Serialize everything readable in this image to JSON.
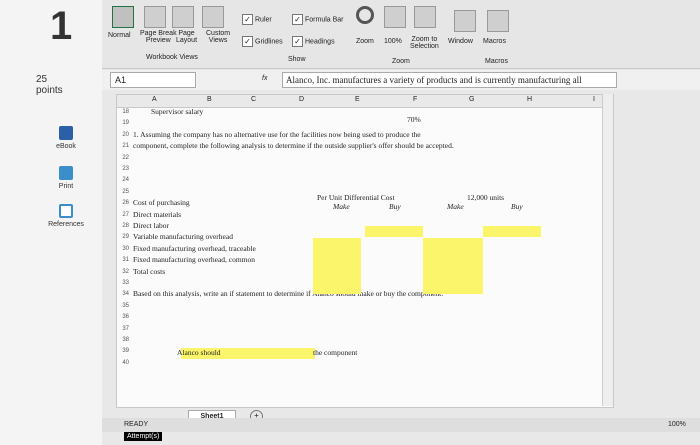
{
  "left": {
    "question_number": "1",
    "points_value": "25",
    "points_label": "points",
    "ebook": "eBook",
    "print": "Print",
    "references": "References"
  },
  "ribbon": {
    "normal": "Normal",
    "page_break": "Page Break",
    "page_break2": "Preview",
    "page_layout": "Page",
    "page_layout2": "Layout",
    "custom_views": "Custom",
    "custom_views2": "Views",
    "workbook_views": "Workbook Views",
    "ruler": "Ruler",
    "formula_bar": "Formula Bar",
    "gridlines": "Gridlines",
    "headings": "Headings",
    "show": "Show",
    "zoom": "Zoom",
    "zoom100": "100%",
    "zoom_to": "Zoom to",
    "selection": "Selection",
    "zoom_group": "Zoom",
    "window": "Window",
    "macros": "Macros",
    "macros_group": "Macros"
  },
  "formula_bar": {
    "cell_ref": "A1",
    "fx": "fx",
    "content": "Alanco, Inc. manufactures a variety of products and is currently manufacturing all"
  },
  "columns": [
    "A",
    "B",
    "C",
    "D",
    "E",
    "F",
    "G",
    "H",
    "I"
  ],
  "rows": [
    {
      "num": "18",
      "text": "Supervisor salary",
      "right": "70%"
    },
    {
      "num": "19",
      "text": ""
    },
    {
      "num": "20",
      "text": "1. Assuming the company has no alternative use for the facilities now being used to produce the"
    },
    {
      "num": "21",
      "text": "component, complete the following analysis to determine if the outside supplier's offer should be accepted."
    },
    {
      "num": "22",
      "text": ""
    },
    {
      "num": "23",
      "text": ""
    },
    {
      "num": "24",
      "text": ""
    },
    {
      "num": "25",
      "text": ""
    },
    {
      "num": "26",
      "text": "Cost of purchasing"
    },
    {
      "num": "27",
      "text": "Direct materials"
    },
    {
      "num": "28",
      "text": "Direct labor"
    },
    {
      "num": "29",
      "text": "Variable manufacturing overhead"
    },
    {
      "num": "30",
      "text": "Fixed manufacturing overhead, traceable"
    },
    {
      "num": "31",
      "text": "Fixed manufacturing overhead, common"
    },
    {
      "num": "32",
      "text": "Total costs"
    },
    {
      "num": "33",
      "text": ""
    },
    {
      "num": "34",
      "text": "Based on this analysis, write an if statement to determine if Alanco should make or buy the component."
    },
    {
      "num": "35",
      "text": ""
    },
    {
      "num": "36",
      "text": ""
    },
    {
      "num": "37",
      "text": ""
    },
    {
      "num": "38",
      "text": ""
    },
    {
      "num": "39",
      "text": ""
    },
    {
      "num": "40",
      "text": ""
    }
  ],
  "table": {
    "per_unit": "Per Unit Differential Cost",
    "units": "12,000 units",
    "make1": "Make",
    "buy1": "Buy",
    "make2": "Make",
    "buy2": "Buy"
  },
  "answer": {
    "alanco_should": "Alanco should",
    "the_component": "the component"
  },
  "sheet": {
    "tab": "Sheet1"
  },
  "status": {
    "ready": "READY",
    "attempt": "Attempt(s)",
    "zoom": "100%"
  },
  "colors": {
    "highlight": "#fbf56b",
    "accent": "#217346"
  }
}
